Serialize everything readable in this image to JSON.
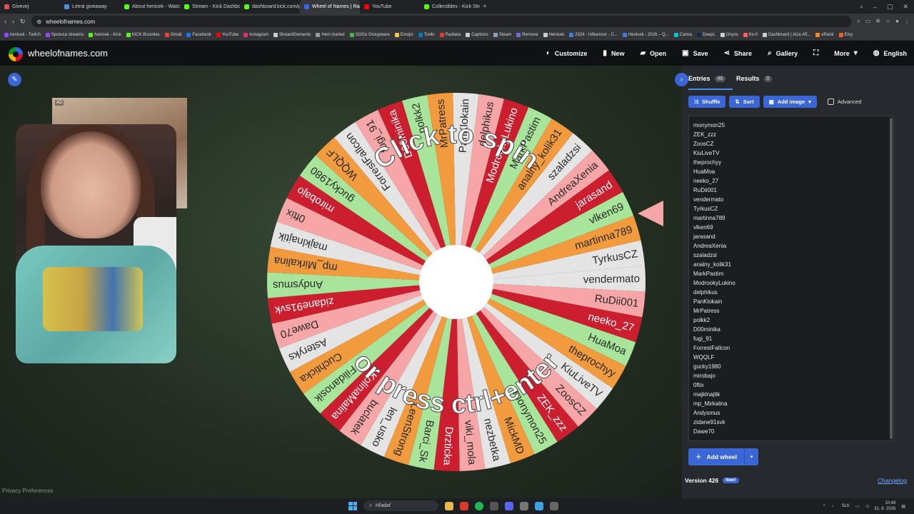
{
  "browser": {
    "tabs": [
      {
        "label": "Givevej",
        "color": "#e05050"
      },
      {
        "label": "Letná giveaway",
        "color": "#4a90e2"
      },
      {
        "label": "About henicek - Watch Li",
        "color": "#53fc18"
      },
      {
        "label": "Stream - Kick Dashboard",
        "color": "#53fc18"
      },
      {
        "label": "dashboard.kick.com/pop",
        "color": "#53fc18"
      },
      {
        "label": "Wheel of Names | Rando",
        "color": "#3369e8",
        "active": true
      },
      {
        "label": "YouTube",
        "color": "#ff0000"
      },
      {
        "label": "Collectibles - Kick Stream",
        "color": "#53fc18"
      }
    ],
    "new_tab": "+",
    "url": "wheelofnames.com",
    "bookmarks": [
      {
        "label": "henicek - Twitch",
        "color": "#9146ff"
      },
      {
        "label": "Správca streamu",
        "color": "#9146ff"
      },
      {
        "label": "henicek - Kick",
        "color": "#53fc18"
      },
      {
        "label": "KICK Bounties",
        "color": "#53fc18"
      },
      {
        "label": "Gmail",
        "color": "#ea4335"
      },
      {
        "label": "Facebook",
        "color": "#1877f2"
      },
      {
        "label": "YouTube",
        "color": "#ff0000"
      },
      {
        "label": "Instagram",
        "color": "#e1306c"
      },
      {
        "label": "StreamElements",
        "color": "#cccccc"
      },
      {
        "label": "Heni market",
        "color": "#999999"
      },
      {
        "label": "SOGo Groupware",
        "color": "#4caf50"
      },
      {
        "label": "Emojis",
        "color": "#f5c542"
      },
      {
        "label": "Trello",
        "color": "#0079bf"
      },
      {
        "label": "Packeta",
        "color": "#e53935"
      },
      {
        "label": "Captions",
        "color": "#cccccc"
      },
      {
        "label": "Steam",
        "color": "#8aa0b8"
      },
      {
        "label": "Remove",
        "color": "#6f6fd8"
      },
      {
        "label": "Henicek",
        "color": "#cccccc"
      },
      {
        "label": "2024 - Influencer - C...",
        "color": "#3f7de0"
      },
      {
        "label": "Henicek - 2026 – Q...",
        "color": "#3f7de0"
      },
      {
        "label": "Canva",
        "color": "#00c4cc"
      },
      {
        "label": "DeepL",
        "color": "#0f2b46"
      },
      {
        "label": "Onyxx",
        "color": "#cccccc"
      },
      {
        "label": "Ko-fi",
        "color": "#ff5e5b"
      },
      {
        "label": "Dashboard | Alza Aff...",
        "color": "#cccccc"
      },
      {
        "label": "eRank",
        "color": "#f08a24"
      },
      {
        "label": "Etsy",
        "color": "#f1641e"
      }
    ]
  },
  "app": {
    "site_name": "wheelofnames.com",
    "menu": [
      {
        "label": "Customize",
        "icon": "palette-icon",
        "glyph": "◐"
      },
      {
        "label": "New",
        "icon": "file-icon",
        "glyph": "▮"
      },
      {
        "label": "Open",
        "icon": "folder-icon",
        "glyph": "▰"
      },
      {
        "label": "Save",
        "icon": "save-icon",
        "glyph": "▣"
      },
      {
        "label": "Share",
        "icon": "share-icon",
        "glyph": "⋖"
      },
      {
        "label": "Gallery",
        "icon": "search-icon",
        "glyph": "⌕"
      },
      {
        "label": "",
        "icon": "fullscreen-icon",
        "glyph": "⛶"
      },
      {
        "label": "More",
        "icon": "chevron-down-icon",
        "glyph": "▾"
      },
      {
        "label": "English",
        "icon": "globe-icon",
        "glyph": "◍"
      }
    ]
  },
  "stage": {
    "privacy": "Privacy Preferences",
    "ad_label": "AD",
    "spin_text_top": "Click to spin",
    "spin_text_bottom": "or press ctrl+enter"
  },
  "wheel": {
    "colors": [
      "#e4e4e4",
      "#f6a6a6",
      "#cb1e2e",
      "#a8e59a",
      "#f19a3e"
    ],
    "names": [
      "vendermato",
      "RuDii001",
      "neeko_27",
      "HuaMoa",
      "theprochyy",
      "KiuLiveTV",
      "ZoosCZ",
      "ZEK_zzz",
      "monymon25",
      "MickMD",
      "nezbetka",
      "viki_mola",
      "Drzticka",
      "Barci_Sk",
      "LeenStrong",
      "len_usko",
      "buclatek",
      "KolinaMalina",
      "Filidanosik",
      "Cuchticka",
      "Asteryks",
      "Dawe70",
      "zidane91svk",
      "Andysmus",
      "mp_Mirkalina",
      "majklnajtik",
      "0ftix",
      "mirobajo",
      "gucky1980",
      "WQQLF",
      "ForrestFallcon",
      "fugi_91",
      "D00minika",
      "polkk2",
      "MrPatress",
      "PanKlokain",
      "delphikus",
      "ModrookyLukino",
      "MarkPastim",
      "analny_kolik31",
      "szaladzsi",
      "AndreaXenia",
      "jarasand",
      "vlken69",
      "martinna789",
      "TyrkusCZ"
    ]
  },
  "panel": {
    "tabs": [
      {
        "label": "Entries",
        "count": "46"
      },
      {
        "label": "Results",
        "count": "0"
      }
    ],
    "shuffle": "Shuffle",
    "sort": "Sort",
    "add_image": "Add image",
    "advanced": "Advanced",
    "entries": [
      "monymon25",
      "ZEK_zzz",
      "ZoosCZ",
      "KiuLiveTV",
      "theprochyy",
      "HuaMoa",
      "neeko_27",
      "RuDii001",
      "vendermato",
      "TyrkusCZ",
      "martinna789",
      "vlken69",
      "jarasand",
      "AndreaXenia",
      "szaladzsi",
      "analny_kolik31",
      "MarkPastim",
      "ModrookyLukino",
      "delphikus",
      "PanKlokain",
      "MrPatress",
      "polkk2",
      "D00minika",
      "fugi_91",
      "ForrestFallcon",
      "WQQLF",
      "gucky1980",
      "mirobajo",
      "0ftix",
      "majklnajtik",
      "mp_Mirkalina",
      "Andysmus",
      "zidane91svk",
      "Dawe70"
    ],
    "add_wheel": "Add wheel",
    "version": "Version 426",
    "new_badge": "New!",
    "changelog": "Changelog"
  },
  "taskbar": {
    "search": "Hľadať",
    "lang": "SLK",
    "time": "10:49",
    "date": "31. 8. 2026"
  }
}
